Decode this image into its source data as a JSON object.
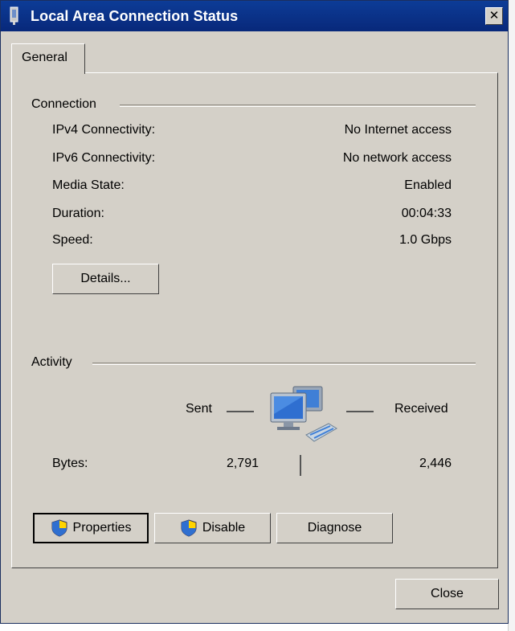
{
  "window": {
    "title": "Local Area Connection Status"
  },
  "tabs": [
    {
      "label": "General"
    }
  ],
  "connection": {
    "group_label": "Connection",
    "rows": [
      {
        "label": "IPv4 Connectivity:",
        "value": "No Internet access"
      },
      {
        "label": "IPv6 Connectivity:",
        "value": "No network access"
      },
      {
        "label": "Media State:",
        "value": "Enabled"
      },
      {
        "label": "Duration:",
        "value": "00:04:33"
      },
      {
        "label": "Speed:",
        "value": "1.0 Gbps"
      }
    ],
    "details_label": "Details..."
  },
  "activity": {
    "group_label": "Activity",
    "sent_label": "Sent",
    "received_label": "Received",
    "bytes_label": "Bytes:",
    "bytes_sent": "2,791",
    "bytes_received": "2,446"
  },
  "buttons": {
    "properties": "Properties",
    "disable": "Disable",
    "diagnose": "Diagnose",
    "close": "Close"
  },
  "icons": {
    "title": "network-connection-icon",
    "network": "network-computers-icon",
    "shield": "uac-shield-icon",
    "close": "close-icon"
  },
  "colors": {
    "titlebar": "#0d3c97",
    "dialog_bg": "#d4d0c8"
  }
}
